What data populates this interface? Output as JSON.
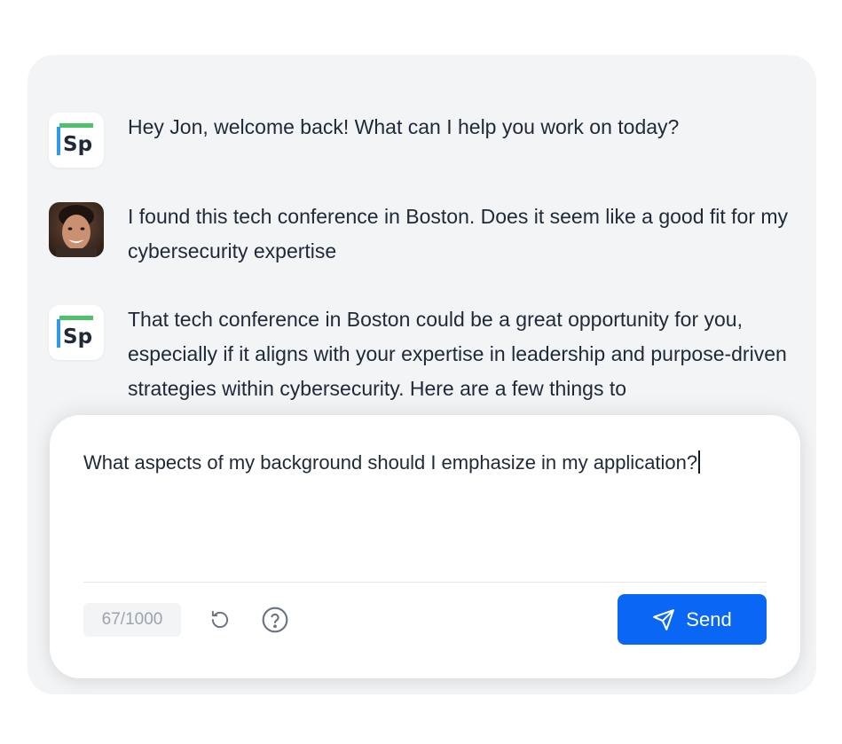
{
  "messages": [
    {
      "sender": "assistant",
      "avatar_icon": "sp-logo-icon",
      "avatar_text": "Sp",
      "text": "Hey Jon, welcome back! What can I help you work on today?"
    },
    {
      "sender": "user",
      "avatar_icon": "user-avatar-photo",
      "text": "I found this tech conference in Boston. Does it seem like a good fit for my cybersecurity expertise"
    },
    {
      "sender": "assistant",
      "avatar_icon": "sp-logo-icon",
      "avatar_text": "Sp",
      "text": "That tech conference in Boston could be a great opportunity for you, especially if it aligns with your expertise in leadership and purpose-driven strategies within cybersecurity. Here are a few things to"
    }
  ],
  "composer": {
    "value": "What aspects of my background should I emphasize in my application?",
    "char_count": "67/1000",
    "reset_icon": "refresh-icon",
    "help_icon": "help-circle-icon",
    "send_label": "Send",
    "send_icon": "paper-plane-icon"
  },
  "colors": {
    "accent": "#0a66f5",
    "logo_green": "#4bc26b",
    "logo_blue": "#2f9be8",
    "panel_bg": "#f3f4f6"
  }
}
